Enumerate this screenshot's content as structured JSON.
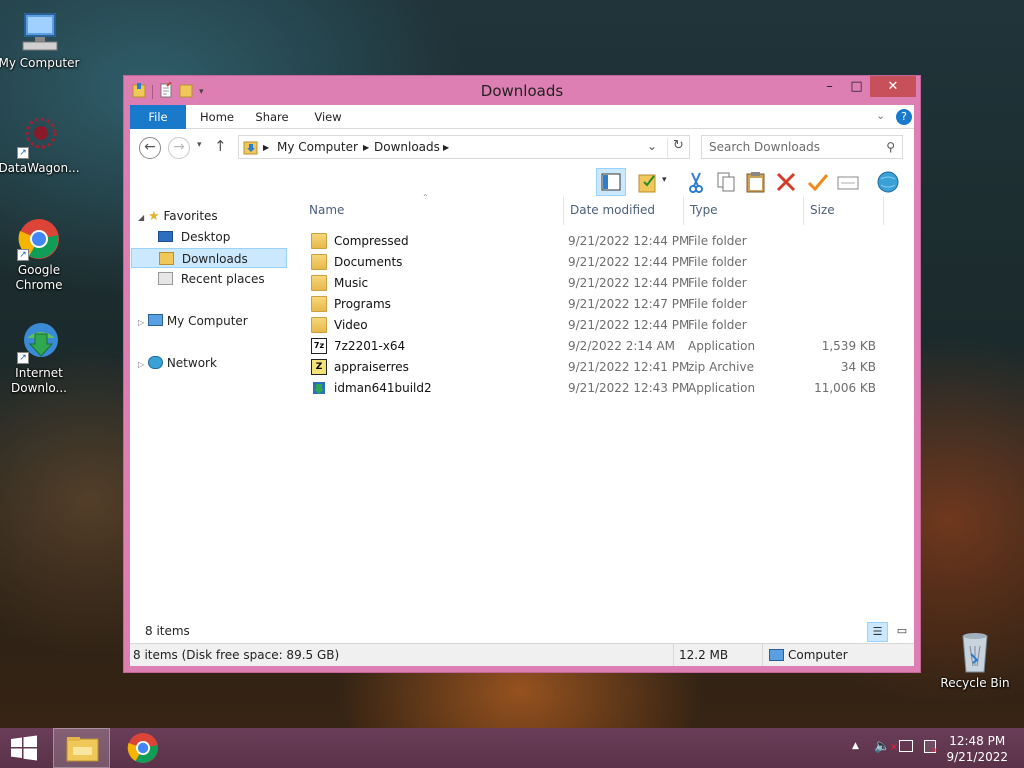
{
  "desktop": {
    "icons": [
      {
        "label": "My Computer",
        "icon": "my-computer-icon"
      },
      {
        "label": "DataWagon...",
        "icon": "datawagon-icon"
      },
      {
        "label": "Google Chrome",
        "icon": "chrome-icon"
      },
      {
        "label": "Internet Downlo...",
        "icon": "internet-download-manager-icon"
      },
      {
        "label": "Recycle Bin",
        "icon": "recycle-bin-icon"
      }
    ]
  },
  "window": {
    "title": "Downloads",
    "controls": {
      "minimize": "–",
      "maximize": "□",
      "close": "✕"
    },
    "ribbon_tabs": [
      "File",
      "Home",
      "Share",
      "View"
    ],
    "address": {
      "crumbs": [
        "My Computer",
        "Downloads"
      ],
      "search_placeholder": "Search Downloads"
    },
    "navigation": {
      "favorites": "Favorites",
      "favorites_items": [
        "Desktop",
        "Downloads",
        "Recent places"
      ],
      "computer": "My Computer",
      "network": "Network",
      "selected": "Downloads"
    },
    "columns": [
      "Name",
      "Date modified",
      "Type",
      "Size"
    ],
    "files": [
      {
        "name": "Compressed",
        "date": "9/21/2022 12:44 PM",
        "type": "File folder",
        "size": "",
        "icon": "folder-icon"
      },
      {
        "name": "Documents",
        "date": "9/21/2022 12:44 PM",
        "type": "File folder",
        "size": "",
        "icon": "folder-icon"
      },
      {
        "name": "Music",
        "date": "9/21/2022 12:44 PM",
        "type": "File folder",
        "size": "",
        "icon": "folder-icon"
      },
      {
        "name": "Programs",
        "date": "9/21/2022 12:47 PM",
        "type": "File folder",
        "size": "",
        "icon": "folder-icon"
      },
      {
        "name": "Video",
        "date": "9/21/2022 12:44 PM",
        "type": "File folder",
        "size": "",
        "icon": "folder-icon"
      },
      {
        "name": "7z2201-x64",
        "date": "9/2/2022 2:14 AM",
        "type": "Application",
        "size": "1,539 KB",
        "icon": "7zip-icon"
      },
      {
        "name": "appraiserres",
        "date": "9/21/2022 12:41 PM",
        "type": "zip Archive",
        "size": "34 KB",
        "icon": "zip-archive-icon"
      },
      {
        "name": "idman641build2",
        "date": "9/21/2022 12:43 PM",
        "type": "Application",
        "size": "11,006 KB",
        "icon": "idm-installer-icon"
      }
    ],
    "item_count": "8 items",
    "status": {
      "left": "8 items (Disk free space: 89.5 GB)",
      "size": "12.2 MB",
      "location": "Computer"
    }
  },
  "taskbar": {
    "time": "12:48 PM",
    "date": "9/21/2022"
  },
  "colors": {
    "window_frame": "#de7fb3",
    "file_tab": "#1979ca",
    "selection": "#cce8ff",
    "taskbar": "#5a3249"
  }
}
